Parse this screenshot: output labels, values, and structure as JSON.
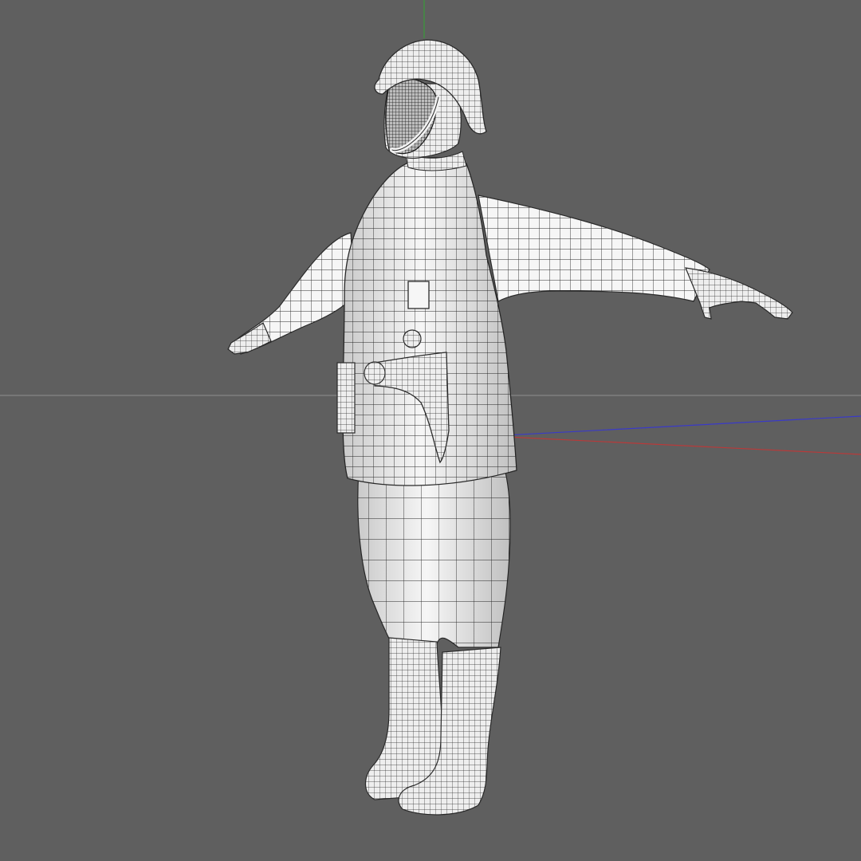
{
  "viewport": {
    "background_color": "#5f5f5f",
    "model": {
      "fill_color": "#f6f6f6",
      "shade_color": "#cfcfcf",
      "wire_color": "#2a2a2a"
    },
    "axes": {
      "x_axis_color": "#b83a3a",
      "y_axis_color": "#3a9a3a",
      "z_axis_color": "#3a3ac8",
      "horizon_color": "#8f8f8f"
    }
  }
}
